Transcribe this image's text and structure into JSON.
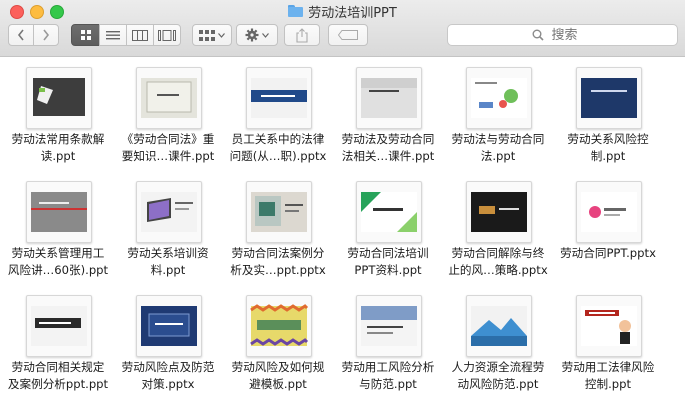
{
  "window": {
    "title": "劳动法培训PPT"
  },
  "search": {
    "placeholder": "搜索"
  },
  "toolbar": {
    "back_icon": "‹",
    "forward_icon": "›",
    "view_modes": [
      "icon-view",
      "list-view",
      "column-view",
      "gallery-view"
    ],
    "active_view": "icon-view"
  },
  "files": [
    {
      "name": "劳动法常用条款解读.ppt",
      "label": "劳动法常用条款解\n读.ppt",
      "style": "dark-doc"
    },
    {
      "name": "《劳动合同法》重要知识…课件.ppt",
      "label": "《劳动合同法》重\n要知识…课件.ppt",
      "style": "gray-frame"
    },
    {
      "name": "员工关系中的法律问题(从…职).pptx",
      "label": "员工关系中的法律\n问题(从…职).pptx",
      "style": "blue-band"
    },
    {
      "name": "劳动法及劳动合同法相关…课件.ppt",
      "label": "劳动法及劳动合同\n法相关…课件.ppt",
      "style": "gray-title"
    },
    {
      "name": "劳动法与劳动合同法.ppt",
      "label": "劳动法与劳动合同\n法.ppt",
      "style": "green-icons"
    },
    {
      "name": "劳动关系风险控制.ppt",
      "label": "劳动关系风险控\n制.ppt",
      "style": "navy"
    },
    {
      "name": "劳动关系管理用工风险讲…60张).ppt",
      "label": "劳动关系管理用工\n风险讲…60张).ppt",
      "style": "gray-red"
    },
    {
      "name": "劳动关系培训资料.ppt",
      "label": "劳动关系培训资\n料.ppt",
      "style": "laptop"
    },
    {
      "name": "劳动合同法案例分析及实…ppt.pptx",
      "label": "劳动合同法案例分\n析及实…ppt.pptx",
      "style": "office"
    },
    {
      "name": "劳动合同法培训PPT资料.ppt",
      "label": "劳动合同法培训\nPPT资料.ppt",
      "style": "green-tri"
    },
    {
      "name": "劳动合同解除与终止的风…策略.pptx",
      "label": "劳动合同解除与终\n止的风…策略.pptx",
      "style": "black"
    },
    {
      "name": "劳动合同PPT.pptx",
      "label": "劳动合同PPT.pptx",
      "style": "white-logo"
    },
    {
      "name": "劳动合同相关规定及案例分析ppt.ppt",
      "label": "劳动合同相关规定\n及案例分析ppt.ppt",
      "style": "dark-title"
    },
    {
      "name": "劳动风险点及防范对策.pptx",
      "label": "劳动风险点及防范\n对策.pptx",
      "style": "navy-box"
    },
    {
      "name": "劳动风险及如何规避模板.ppt",
      "label": "劳动风险及如何规\n避模板.ppt",
      "style": "zigzag"
    },
    {
      "name": "劳动用工风险分析与防范.ppt",
      "label": "劳动用工风险分析\n与防范.ppt",
      "style": "blue-photo"
    },
    {
      "name": "人力资源全流程劳动风险防范.ppt",
      "label": "人力资源全流程劳\n动风险防范.ppt",
      "style": "mountain"
    },
    {
      "name": "劳动用工法律风险控制.ppt",
      "label": "劳动用工法律风险\n控制.ppt",
      "style": "cartoon"
    }
  ],
  "colors": {
    "selected_segment": "#5d5d5d",
    "folder_blue": "#6cb2ee",
    "close": "#fc605b",
    "minimize": "#fdbc40",
    "maximize": "#34c84a"
  }
}
